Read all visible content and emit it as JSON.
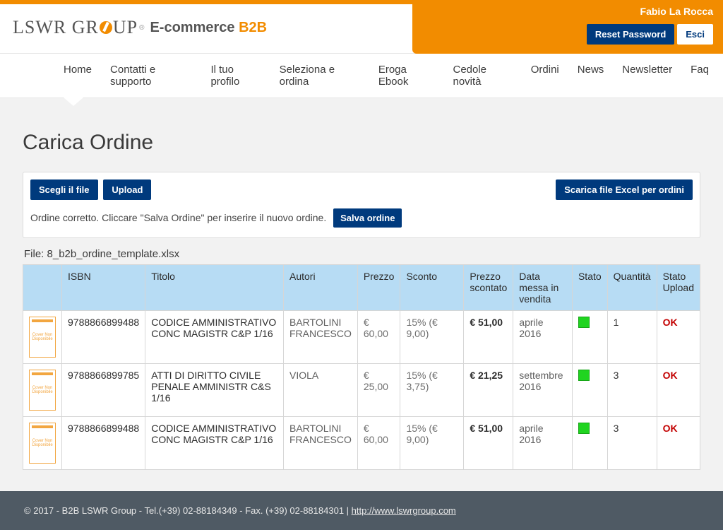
{
  "header": {
    "brand_main": "LSWR GR",
    "brand_tail": "UP",
    "brand_sub_1": "E-commerce ",
    "brand_sub_2": "B2B",
    "reg_mark": "®",
    "user_name": "Fabio La Rocca",
    "btn_reset": "Reset Password",
    "btn_exit": "Esci"
  },
  "nav": {
    "items": [
      "Home",
      "Contatti e supporto",
      "Il tuo profilo",
      "Seleziona e ordina",
      "Eroga Ebook",
      "Cedole novità",
      "Ordini",
      "News",
      "Newsletter",
      "Faq"
    ]
  },
  "page": {
    "title": "Carica Ordine",
    "btn_choose": "Scegli il file",
    "btn_upload": "Upload",
    "btn_download": "Scarica file Excel per ordini",
    "message": "Ordine corretto. Cliccare \"Salva Ordine\" per inserire il nuovo ordine.",
    "btn_save": "Salva ordine",
    "file_label": "File: 8_b2b_ordine_template.xlsx"
  },
  "table": {
    "headers": {
      "cover": "",
      "isbn": "ISBN",
      "title": "Titolo",
      "author": "Autori",
      "price": "Prezzo",
      "discount": "Sconto",
      "dprice": "Prezzo scontato",
      "date": "Data messa in vendita",
      "state": "Stato",
      "qty": "Quantità",
      "upload": "Stato Upload"
    },
    "cover_text": "Cover Non Disponibile",
    "rows": [
      {
        "isbn": "9788866899488",
        "title": "CODICE AMMINISTRATIVO CONC MAGISTR C&P 1/16",
        "author": "BARTOLINI FRANCESCO",
        "price": "€ 60,00",
        "discount": "15% (€ 9,00)",
        "dprice": "€ 51,00",
        "date": "aprile 2016",
        "qty": "1",
        "upload": "OK"
      },
      {
        "isbn": "9788866899785",
        "title": "ATTI DI DIRITTO CIVILE PENALE AMMINISTR C&S 1/16",
        "author": "VIOLA",
        "price": "€ 25,00",
        "discount": "15% (€ 3,75)",
        "dprice": "€ 21,25",
        "date": "settembre 2016",
        "qty": "3",
        "upload": "OK"
      },
      {
        "isbn": "9788866899488",
        "title": "CODICE AMMINISTRATIVO CONC MAGISTR C&P 1/16",
        "author": "BARTOLINI FRANCESCO",
        "price": "€ 60,00",
        "discount": "15% (€ 9,00)",
        "dprice": "€ 51,00",
        "date": "aprile 2016",
        "qty": "3",
        "upload": "OK"
      }
    ]
  },
  "footer": {
    "text": "© 2017 - B2B LSWR Group - Tel.(+39) 02-88184349 - Fax. (+39) 02-88184301  |  ",
    "link": "http://www.lswrgroup.com"
  }
}
